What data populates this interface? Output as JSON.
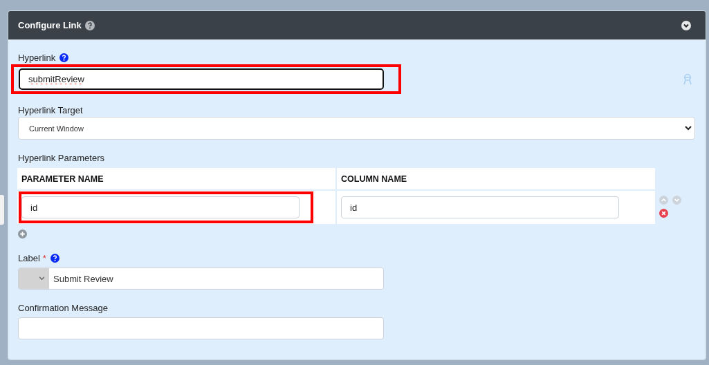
{
  "panel": {
    "title": "Configure Link",
    "expanded": true
  },
  "hyperlink": {
    "label": "Hyperlink",
    "value": "submitReview",
    "highlighted": true
  },
  "hyperlink_target": {
    "label": "Hyperlink Target",
    "value": "Current Window"
  },
  "parameters": {
    "label": "Hyperlink Parameters",
    "columns": [
      "PARAMETER NAME",
      "COLUMN NAME"
    ],
    "rows": [
      {
        "parameter_name": "id",
        "column_name": "id",
        "parameter_highlighted": true,
        "move_up_disabled": true,
        "move_down_disabled": true
      }
    ]
  },
  "label_field": {
    "label": "Label",
    "required_mark": "*",
    "value": "Submit Review"
  },
  "confirmation_message": {
    "label": "Confirmation Message"
  }
}
